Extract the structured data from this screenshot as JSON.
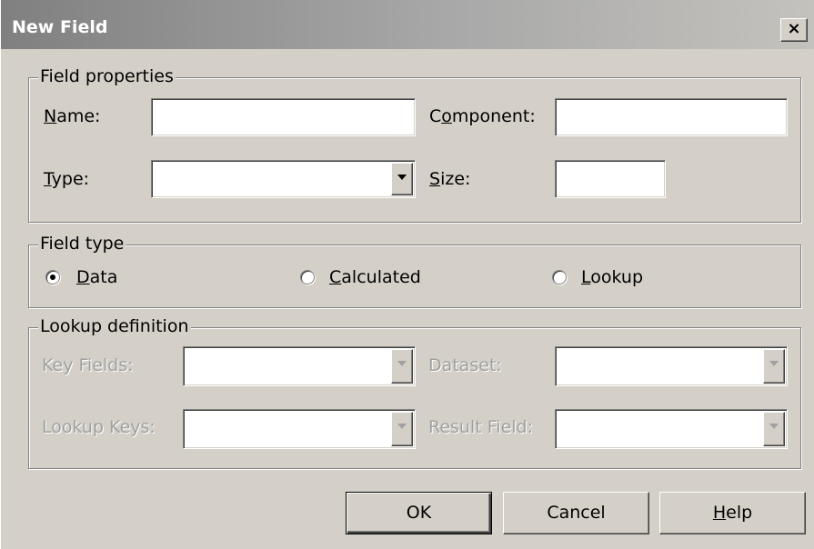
{
  "window": {
    "title": "New Field",
    "close_glyph": "×"
  },
  "field_properties": {
    "legend": "Field properties",
    "name_label": "Name:",
    "name_value": "",
    "component_label": "Component:",
    "component_value": "",
    "type_label": "Type:",
    "type_value": "",
    "size_label": "Size:",
    "size_value": ""
  },
  "field_type": {
    "legend": "Field type",
    "options": [
      {
        "label": "Data",
        "selected": true
      },
      {
        "label": "Calculated",
        "selected": false
      },
      {
        "label": "Lookup",
        "selected": false
      }
    ]
  },
  "lookup_definition": {
    "legend": "Lookup definition",
    "key_fields_label": "Key Fields:",
    "dataset_label": "Dataset:",
    "lookup_keys_label": "Lookup Keys:",
    "result_field_label": "Result Field:"
  },
  "buttons": {
    "ok": "OK",
    "cancel": "Cancel",
    "help": "Help"
  },
  "icons": {
    "dropdown": "chevron-down-icon",
    "close": "close-icon"
  }
}
